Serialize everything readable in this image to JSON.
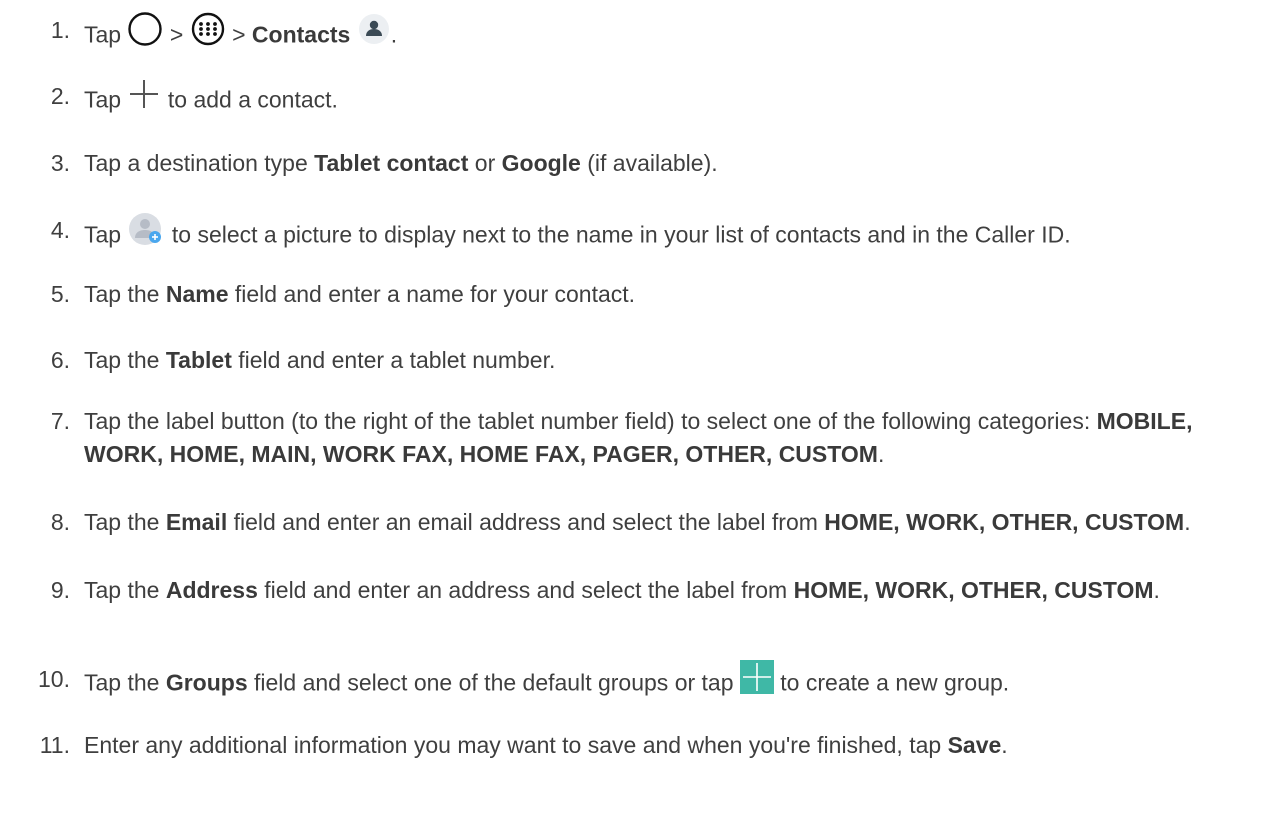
{
  "steps": [
    {
      "number": "1.",
      "parts": [
        {
          "t": "Tap "
        },
        {
          "icon": "home-circle-icon"
        },
        {
          "t": " > "
        },
        {
          "icon": "apps-grid-icon"
        },
        {
          "t": " > "
        },
        {
          "b": "Contacts"
        },
        {
          "t": " "
        },
        {
          "icon": "contacts-app-icon"
        },
        {
          "t": "."
        }
      ]
    },
    {
      "number": "2.",
      "parts": [
        {
          "t": "Tap "
        },
        {
          "icon": "add-plus-icon"
        },
        {
          "t": " to add a contact."
        }
      ]
    },
    {
      "number": "3.",
      "parts": [
        {
          "t": "Tap a destination type "
        },
        {
          "b": "Tablet contact"
        },
        {
          "t": " or "
        },
        {
          "b": "Google"
        },
        {
          "t": " (if available)."
        }
      ]
    },
    {
      "number": "4.",
      "parts": [
        {
          "t": "Tap "
        },
        {
          "icon": "add-photo-icon"
        },
        {
          "t": " to select a picture to display next to the name in your list of contacts and in the Caller ID."
        }
      ]
    },
    {
      "number": "5.",
      "parts": [
        {
          "t": "Tap the "
        },
        {
          "b": "Name"
        },
        {
          "t": " field and enter a name for your contact."
        }
      ]
    },
    {
      "number": "6.",
      "parts": [
        {
          "t": "Tap the "
        },
        {
          "b": "Tablet"
        },
        {
          "t": " field and enter a tablet number."
        }
      ]
    },
    {
      "number": "7.",
      "parts": [
        {
          "t": "Tap the label button (to the right of the tablet number field) to select one of the following categories: "
        },
        {
          "b": "MOBILE, WORK, HOME, MAIN, WORK FAX, HOME FAX, PAGER, OTHER, CUSTOM"
        },
        {
          "t": "."
        }
      ]
    },
    {
      "number": "8.",
      "parts": [
        {
          "t": "Tap the "
        },
        {
          "b": "Email"
        },
        {
          "t": " field and enter an email address and select the label from "
        },
        {
          "b": "HOME, WORK, OTHER, CUSTOM"
        },
        {
          "t": "."
        }
      ]
    },
    {
      "number": "9.",
      "parts": [
        {
          "t": "Tap the "
        },
        {
          "b": "Address"
        },
        {
          "t": " field and enter an address and select the label from "
        },
        {
          "b": "HOME, WORK, OTHER, CUSTOM"
        },
        {
          "t": "."
        }
      ]
    },
    {
      "number": "10.",
      "parts": [
        {
          "t": "Tap the "
        },
        {
          "b": "Groups"
        },
        {
          "t": " field and select one of the default groups or tap "
        },
        {
          "icon": "add-group-icon"
        },
        {
          "t": " to create a new group."
        }
      ]
    },
    {
      "number": "11.",
      "parts": [
        {
          "t": "Enter any additional information you may want to save and when you're finished, tap "
        },
        {
          "b": "Save"
        },
        {
          "t": "."
        }
      ]
    }
  ],
  "colors": {
    "text": "#3f3f3f",
    "group_icon": "#3fb8a6",
    "avatar_bg": "#d9dde3",
    "avatar_fg": "#b6bcc6",
    "badge": "#4aa7ee"
  }
}
